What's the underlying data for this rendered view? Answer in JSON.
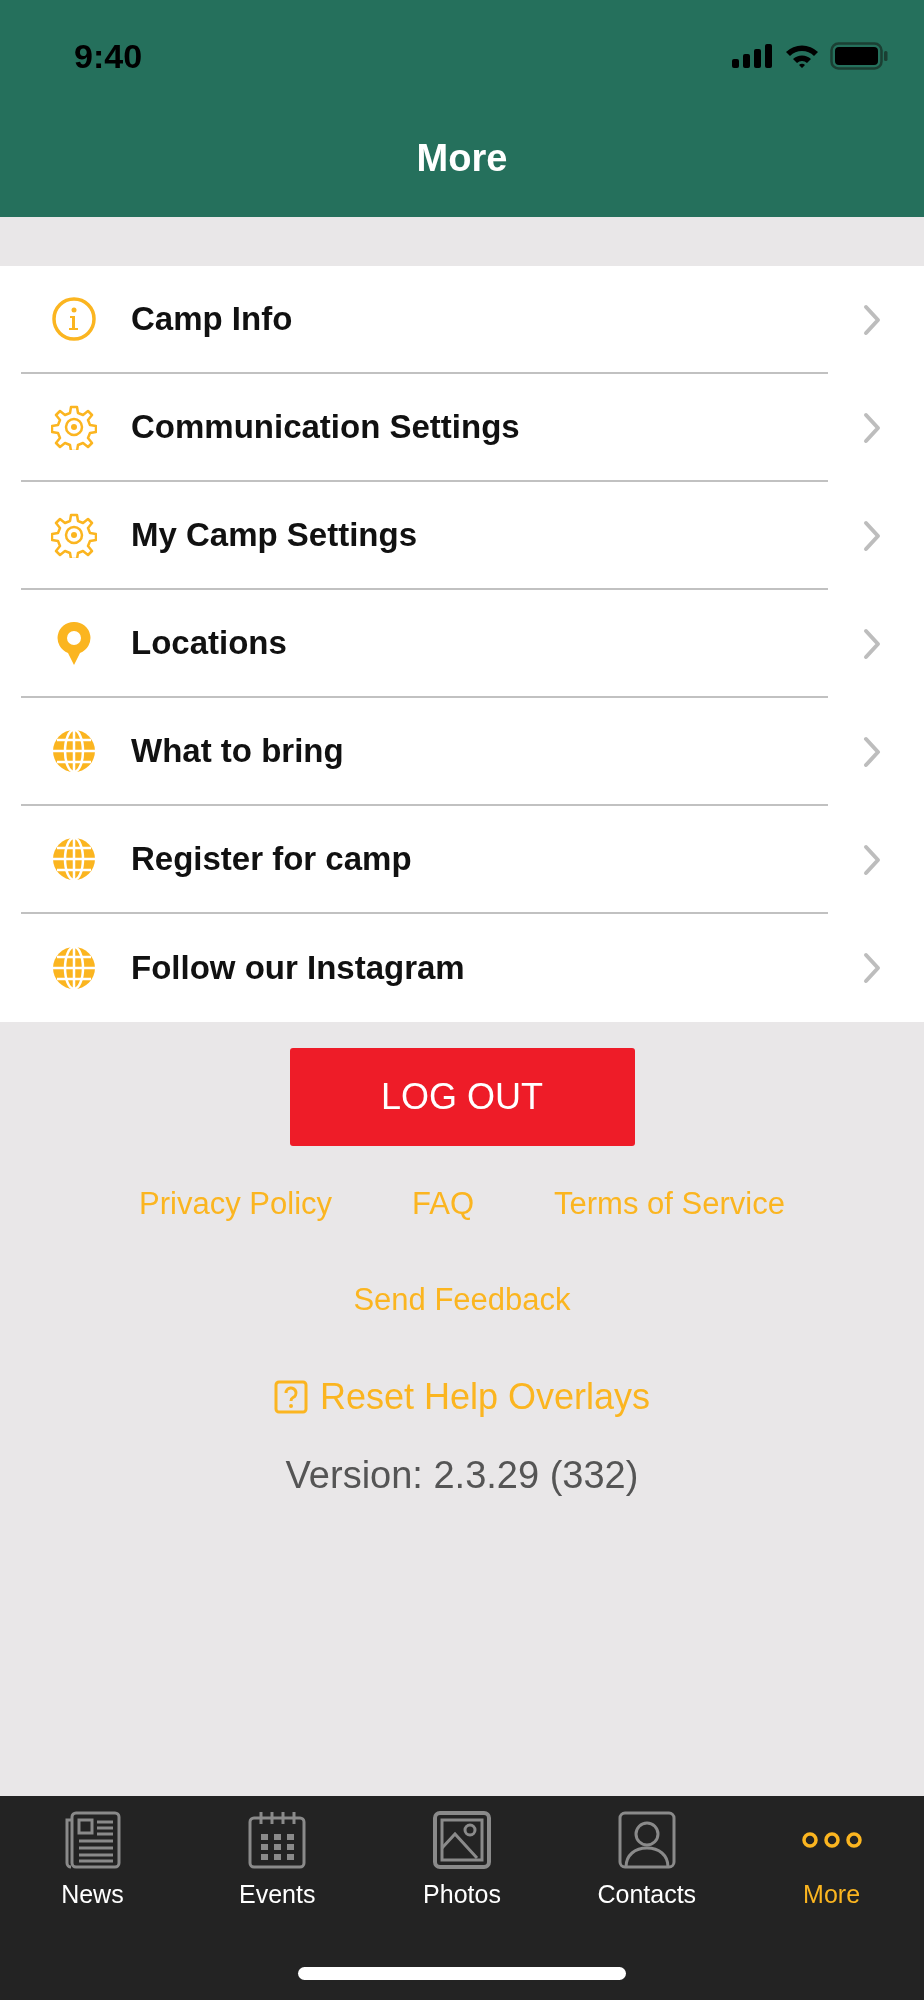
{
  "status_bar": {
    "time": "9:40"
  },
  "header": {
    "title": "More"
  },
  "menu": [
    {
      "label": "Camp Info",
      "kind": "info"
    },
    {
      "label": "Communication Settings",
      "kind": "gear"
    },
    {
      "label": "My Camp Settings",
      "kind": "gear"
    },
    {
      "label": "Locations",
      "kind": "pin"
    },
    {
      "label": "What to bring",
      "kind": "globe"
    },
    {
      "label": "Register for camp",
      "kind": "globe"
    },
    {
      "label": "Follow our Instagram",
      "kind": "globe"
    }
  ],
  "logout_button": "LOG OUT",
  "links": [
    "Privacy Policy",
    "FAQ",
    "Terms of Service"
  ],
  "feedback_link": "Send Feedback",
  "reset_help": "Reset Help Overlays",
  "version": "Version: 2.3.29 (332)",
  "tabs": [
    {
      "label": "News",
      "kind": "news",
      "selected": false
    },
    {
      "label": "Events",
      "kind": "calendar",
      "selected": false
    },
    {
      "label": "Photos",
      "kind": "photo",
      "selected": false
    },
    {
      "label": "Contacts",
      "kind": "contact",
      "selected": false
    },
    {
      "label": "More",
      "kind": "more",
      "selected": true
    }
  ]
}
